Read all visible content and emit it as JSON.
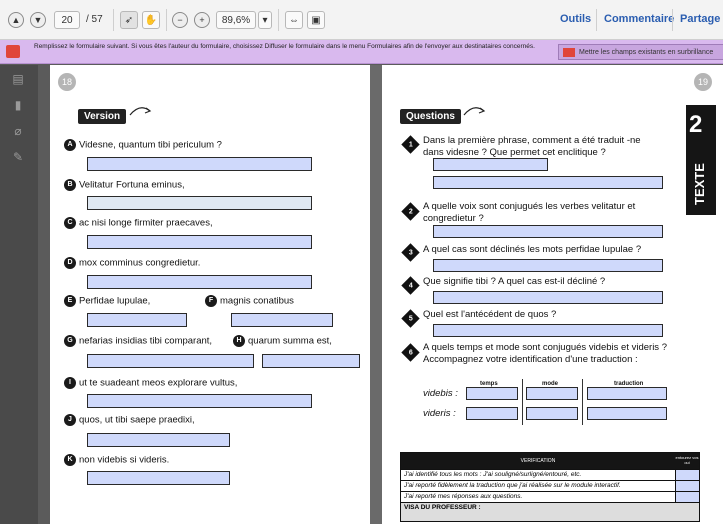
{
  "toolbar": {
    "page_current": "20",
    "page_total": "/ 57",
    "zoom": "89,6%",
    "links": [
      "Outils",
      "Commentaire",
      "Partage"
    ]
  },
  "notice": {
    "text": "Remplissez le formulaire suivant. Si vous êtes l'auteur du formulaire, choisissez Diffuser le formulaire dans le menu Formulaires afin de l'envoyer aux destinataires concernés.",
    "button": "Mettre les champs existants en surbrillance"
  },
  "left_page": {
    "number": "18",
    "section": "Version",
    "items": [
      {
        "letter": "A",
        "text": "Videsne, quantum tibi periculum ?"
      },
      {
        "letter": "B",
        "text": "Velitatur Fortuna eminus,"
      },
      {
        "letter": "C",
        "text": "ac nisi longe firmiter praecaves,"
      },
      {
        "letter": "D",
        "text": "mox comminus congredietur."
      },
      {
        "letter": "E",
        "text": "Perfidae lupulae,"
      },
      {
        "letter": "F",
        "text": "magnis conatibus"
      },
      {
        "letter": "G",
        "text": "nefarias insidias tibi comparant,"
      },
      {
        "letter": "H",
        "text": "quarum summa est,"
      },
      {
        "letter": "I",
        "text": "ut te suadeant meos explorare vultus,"
      },
      {
        "letter": "J",
        "text": "quos, ut tibi saepe praedixi,"
      },
      {
        "letter": "K",
        "text": "non videbis si videris."
      }
    ]
  },
  "right_page": {
    "number": "19",
    "section": "Questions",
    "tab_label": "TEXTE",
    "tab_number": "2",
    "questions": [
      "Dans la première phrase, comment a été traduit -ne dans videsne ? Que permet cet enclitique ?",
      "A quelle voix sont conjugués les verbes velitatur et congredietur ?",
      "A quel cas sont déclinés les mots perfidae lupulae ?",
      "Que signifie tibi ? A quel cas est-il décliné ?",
      "Quel est l'antécédent de quos ?",
      "A quels temps et mode sont conjugués videbis et videris ? Accompagnez votre identification d'une traduction :"
    ],
    "table_cols": [
      "temps",
      "mode",
      "traduction"
    ],
    "table_rows": [
      "videbis :",
      "videris :"
    ],
    "verif_title": "VERIFICATION",
    "verif_col": "entourez vos oui",
    "verif_rows": [
      "J'ai identifié tous les mots : J'ai souligné/surligné/entouré, etc.",
      "J'ai reporté fidèlement la traduction que j'ai réalisée sur le module interactif.",
      "J'ai reporté mes réponses aux questions.",
      "VISA DU PROFESSEUR :"
    ]
  }
}
